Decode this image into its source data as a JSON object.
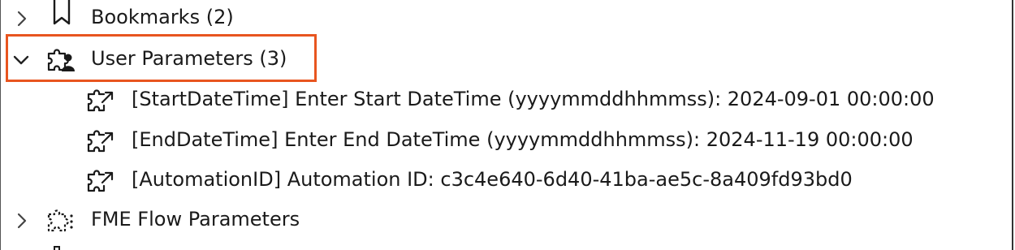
{
  "tree": {
    "bookmarks": {
      "label": "Bookmarks (2)",
      "icon": "bookmark-icon",
      "expanded": false
    },
    "user_parameters": {
      "label": "User Parameters (3)",
      "icon": "user-parameters-icon",
      "expanded": true,
      "children": [
        {
          "label": "[StartDateTime] Enter Start DateTime (yyyymmddhhmmss): 2024-09-01 00:00:00",
          "icon": "published-parameter-icon"
        },
        {
          "label": "[EndDateTime] Enter End DateTime (yyyymmddhhmmss): 2024-11-19 00:00:00",
          "icon": "published-parameter-icon"
        },
        {
          "label": "[AutomationID] Automation ID: c3c4e640-6d40-41ba-ae5c-8a409fd93bd0",
          "icon": "published-parameter-icon"
        }
      ]
    },
    "fme_flow_parameters": {
      "label": "FME Flow Parameters",
      "icon": "fme-flow-parameters-icon",
      "expanded": false
    }
  },
  "colors": {
    "highlight": "#e8551f",
    "text": "#1a1a1a",
    "icon": "#1a1a1a"
  }
}
